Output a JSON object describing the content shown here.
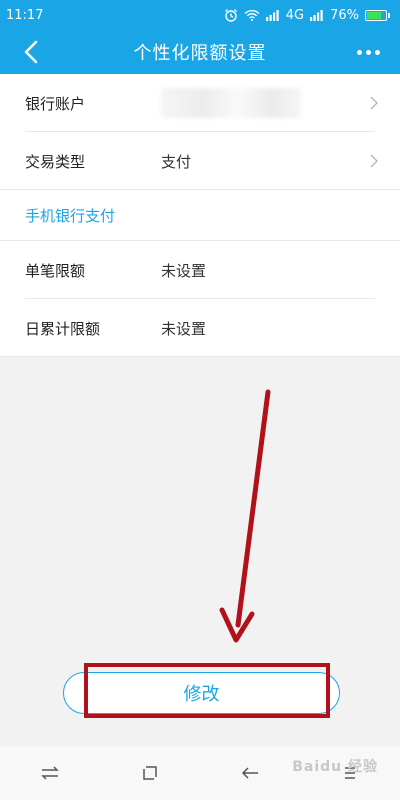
{
  "status_bar": {
    "time": "11:17",
    "network": "4G",
    "battery": "76%",
    "battery_level": 0.76
  },
  "nav": {
    "title": "个性化限额设置"
  },
  "account_section": {
    "rows": [
      {
        "label": "银行账户",
        "value": ""
      },
      {
        "label": "交易类型",
        "value": "支付"
      }
    ]
  },
  "limits_section": {
    "header": "手机银行支付",
    "rows": [
      {
        "label": "单笔限额",
        "value": "未设置"
      },
      {
        "label": "日累计限额",
        "value": "未设置"
      }
    ]
  },
  "action": {
    "modify_label": "修改"
  },
  "watermark": {
    "text": "Baidu 经验"
  },
  "colors": {
    "primary": "#1aa6e6",
    "annotation": "#b0111a",
    "page_background": "#f2f2f2"
  },
  "icons": {
    "back": "chevron-left-icon",
    "more": "more-dots-icon",
    "row_chevron": "chevron-right-icon",
    "alarm": "alarm-icon",
    "wifi": "wifi-icon",
    "signal": "signal-icon",
    "battery": "battery-icon",
    "recents": "switch-arrows-icon",
    "home": "home-square-icon",
    "back_nav": "back-arrow-icon",
    "menu": "menu-icon"
  }
}
